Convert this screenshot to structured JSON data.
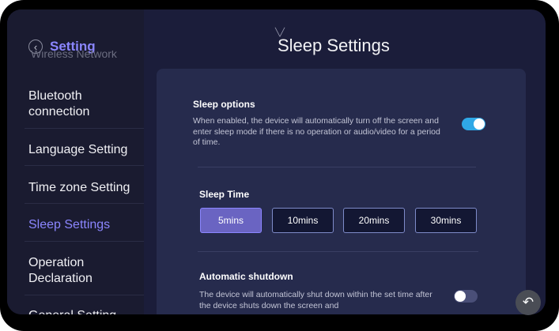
{
  "sidebar": {
    "back_icon": "chevron-left-icon",
    "title": "Setting",
    "partial_item": "Wireless Network",
    "items": [
      {
        "label": "Bluetooth connection"
      },
      {
        "label": "Language Setting"
      },
      {
        "label": "Time zone Setting"
      },
      {
        "label": "Sleep Settings"
      },
      {
        "label": "Operation Declaration"
      },
      {
        "label": "General Setting"
      }
    ]
  },
  "header": {
    "title": "Sleep Settings",
    "pull_indicator_icon": "chevron-down-icon"
  },
  "sleep_options": {
    "label": "Sleep options",
    "description": "When enabled, the device will automatically turn off the screen and enter sleep mode if there is no operation or audio/video for a period of time.",
    "enabled": true
  },
  "sleep_time": {
    "label": "Sleep Time",
    "options": [
      "5mins",
      "10mins",
      "20mins",
      "30mins"
    ],
    "selected": "5mins"
  },
  "auto_shutdown": {
    "label": "Automatic shutdown",
    "description": "The device will automatically shut down within the set time after the device shuts down the screen and",
    "enabled": false
  },
  "floating_button_icon": "return-arrow-icon",
  "colors": {
    "accent": "#8b86ff",
    "toggle_on": "#2fa8e6",
    "background": "#1b1d3a",
    "card": "#262b4d"
  }
}
